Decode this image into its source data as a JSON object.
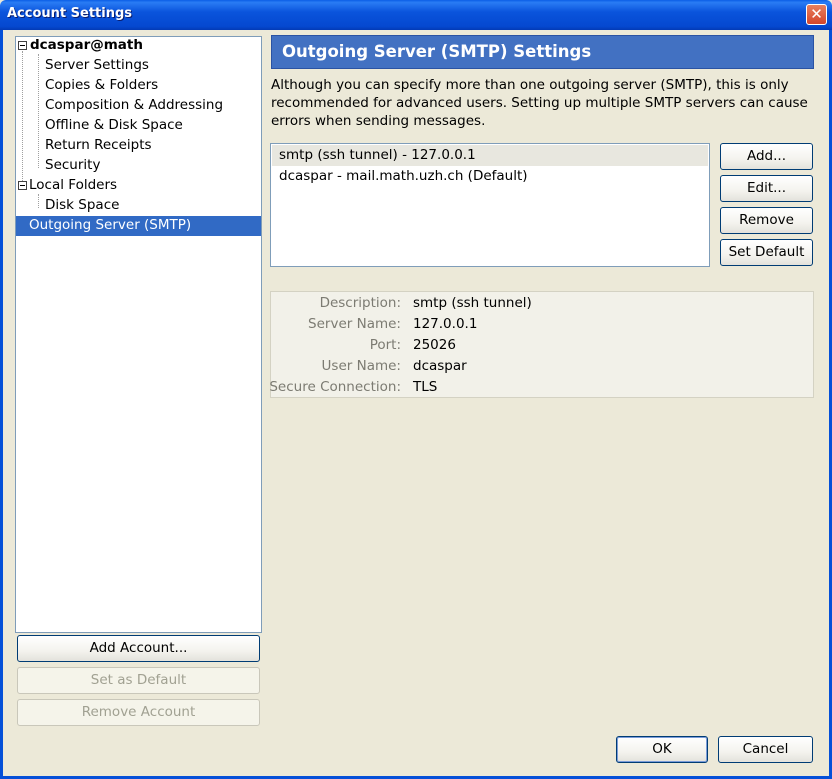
{
  "window": {
    "title": "Account Settings",
    "close_glyph": "✕"
  },
  "tree": {
    "items": [
      {
        "label": "dcaspar@math",
        "kind": "account"
      },
      {
        "label": "Server Settings",
        "kind": "child"
      },
      {
        "label": "Copies & Folders",
        "kind": "child"
      },
      {
        "label": "Composition & Addressing",
        "kind": "child"
      },
      {
        "label": "Offline & Disk Space",
        "kind": "child"
      },
      {
        "label": "Return Receipts",
        "kind": "child"
      },
      {
        "label": "Security",
        "kind": "child"
      },
      {
        "label": "Local Folders",
        "kind": "account"
      },
      {
        "label": "Disk Space",
        "kind": "child"
      },
      {
        "label": "Outgoing Server (SMTP)",
        "kind": "root",
        "selected": true
      }
    ]
  },
  "left_buttons": {
    "add_account": "Add Account...",
    "set_default": "Set as Default",
    "remove_account": "Remove Account"
  },
  "panel": {
    "header": "Outgoing Server (SMTP) Settings",
    "description": "Although you can specify more than one outgoing server (SMTP), this is only recommended for advanced users. Setting up multiple SMTP servers can cause errors when sending messages.",
    "servers": [
      {
        "name": "smtp (ssh tunnel) - 127.0.0.1",
        "selected": true
      },
      {
        "name": "dcaspar - mail.math.uzh.ch (Default)",
        "selected": false
      }
    ],
    "buttons": {
      "add": "Add...",
      "edit": "Edit...",
      "remove": "Remove",
      "set_default": "Set Default"
    },
    "details": {
      "description_label": "Description:",
      "description_value": "smtp (ssh tunnel)",
      "server_name_label": "Server Name:",
      "server_name_value": "127.0.0.1",
      "port_label": "Port:",
      "port_value": "25026",
      "user_name_label": "User Name:",
      "user_name_value": "dcaspar",
      "secure_label": "Secure Connection:",
      "secure_value": "TLS"
    }
  },
  "footer": {
    "ok": "OK",
    "cancel": "Cancel"
  },
  "colors": {
    "title_bar": "#0a54dc",
    "selection": "#316ac5",
    "header_bg": "#4271c2",
    "dialog_bg": "#ece9d8"
  }
}
